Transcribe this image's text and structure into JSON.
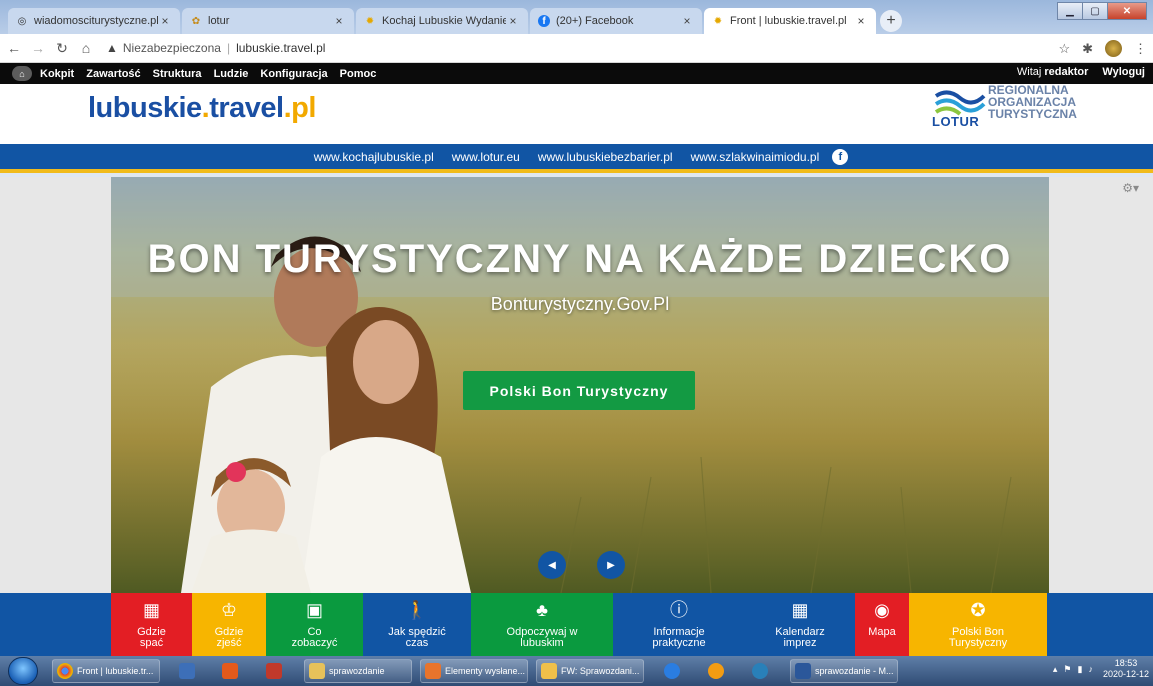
{
  "browser": {
    "tabs": [
      {
        "title": "wiadomosciturystyczne.pl/aktual",
        "icon": "globe-icon",
        "active": false
      },
      {
        "title": "lotur",
        "icon": "site-favicon",
        "active": false
      },
      {
        "title": "Kochaj Lubuskie Wydanie specja",
        "icon": "sun-icon",
        "active": false
      },
      {
        "title": "(20+) Facebook",
        "icon": "facebook-icon",
        "active": false
      },
      {
        "title": "Front | lubuskie.travel.pl",
        "icon": "sun-icon",
        "active": true
      }
    ],
    "close_glyph": "×",
    "new_tab_glyph": "+",
    "security_label": "Niezabezpieczona",
    "url": "lubuskie.travel.pl"
  },
  "admin_toolbar": {
    "items": [
      "Kokpit",
      "Zawartość",
      "Struktura",
      "Ludzie",
      "Konfiguracja",
      "Pomoc"
    ],
    "welcome_prefix": "Witaj",
    "username": "redaktor",
    "logout": "Wyloguj"
  },
  "header": {
    "logo_main": "lubuskie",
    "logo_dot1": ".",
    "logo_mid": "travel",
    "logo_dot2": ".",
    "logo_pl": "pl",
    "org_line1": "REGIONALNA",
    "org_line2": "ORGANIZACJA",
    "org_line3": "TURYSTYCZNA",
    "org_word": "LOTUR"
  },
  "partner_links": [
    "www.kochajlubuskie.pl",
    "www.lotur.eu",
    "www.lubuskiebezbarier.pl",
    "www.szlakwinaimiodu.pl"
  ],
  "hero": {
    "title": "BON TURYSTYCZNY NA KAŻDE DZIECKO",
    "subtitle": "Bonturystyczny.Gov.Pl",
    "cta": "Polski Bon Turystyczny"
  },
  "categories": [
    {
      "label": "Gdzie\nspać",
      "icon": "hotel-icon",
      "color": "#e31e24"
    },
    {
      "label": "Gdzie\nzjeść",
      "icon": "chef-icon",
      "color": "#f7b500"
    },
    {
      "label": "Co\nzobaczyć",
      "icon": "map-frame-icon",
      "color": "#0a9a3f"
    },
    {
      "label": "Jak spędzić\nczas",
      "icon": "walking-person-icon",
      "color": "#1155a4"
    },
    {
      "label": "Odpoczywaj w\nlubuskim",
      "icon": "tree-icon",
      "color": "#0a9a3f"
    },
    {
      "label": "Informacje\npraktyczne",
      "icon": "info-icon",
      "color": "#1155a4"
    },
    {
      "label": "Kalendarz\nimprez",
      "icon": "calendar-icon",
      "color": "#1155a4"
    },
    {
      "label": "Mapa",
      "icon": "location-pin-icon",
      "color": "#e31e24"
    },
    {
      "label": "Polski Bon\nTurystyczny",
      "icon": "bon-icon",
      "color": "#f7b500"
    }
  ],
  "taskbar": {
    "items": [
      "Front | lubuskie.tr...",
      "sprawozdanie",
      "Elementy wysłane...",
      "FW: Sprawozdani...",
      "sprawozdanie - M..."
    ],
    "time": "18:53",
    "date": "2020-12-12"
  }
}
